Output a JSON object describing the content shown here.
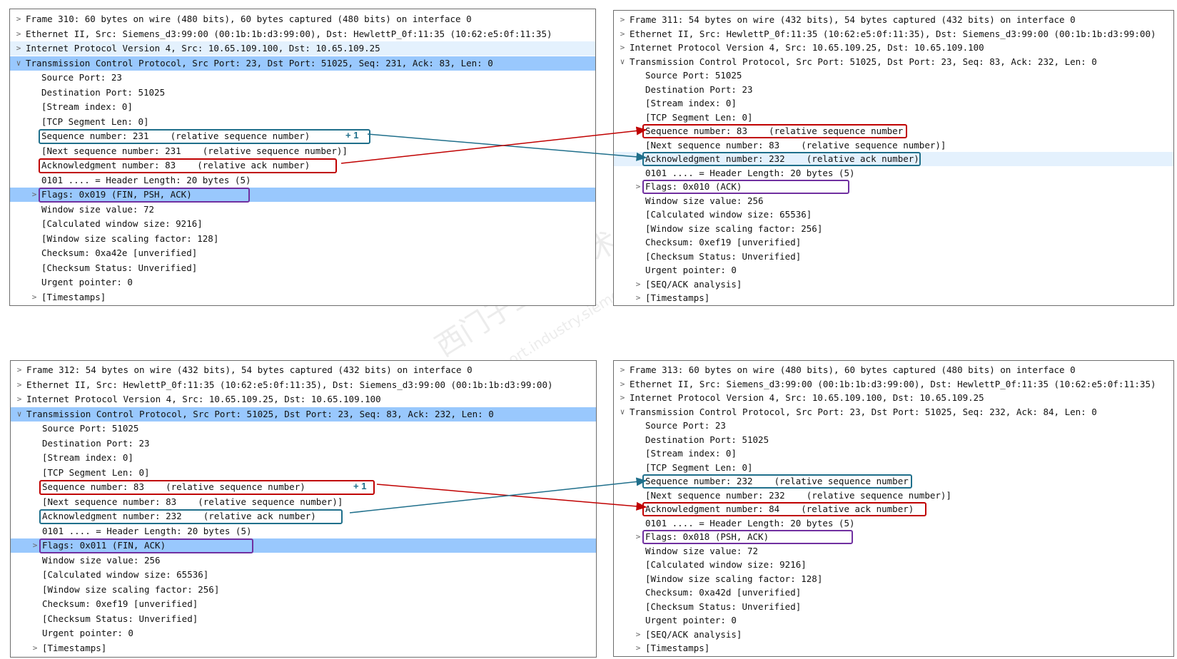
{
  "watermark": {
    "line1": "西门子工业 技术",
    "line2": "support.industry.siemens.com"
  },
  "frames": [
    {
      "id": "frame-310",
      "rows": [
        {
          "text": "Frame 310: 60 bytes on wire (480 bits), 60 bytes captured (480 bits) on interface 0",
          "arrow": ">",
          "indent": 0
        },
        {
          "text": "Ethernet II, Src: Siemens_d3:99:00 (00:1b:1b:d3:99:00), Dst: HewlettP_0f:11:35 (10:62:e5:0f:11:35)",
          "arrow": ">",
          "indent": 0
        },
        {
          "text": "Internet Protocol Version 4, Src: 10.65.109.100, Dst: 10.65.109.25",
          "arrow": ">",
          "indent": 0,
          "hl": true
        },
        {
          "text": "Transmission Control Protocol, Src Port: 23, Dst Port: 51025, Seq: 231, Ack: 83, Len: 0",
          "arrow": "v",
          "indent": 0,
          "sel": true
        },
        {
          "text": "Source Port: 23",
          "arrow": "",
          "indent": 1
        },
        {
          "text": "Destination Port: 51025",
          "arrow": "",
          "indent": 1
        },
        {
          "text": "[Stream index: 0]",
          "arrow": "",
          "indent": 1
        },
        {
          "text": "[TCP Segment Len: 0]",
          "arrow": "",
          "indent": 1
        },
        {
          "text": "Sequence number: 231    (relative sequence number)",
          "arrow": "",
          "indent": 1
        },
        {
          "text": "[Next sequence number: 231    (relative sequence number)]",
          "arrow": "",
          "indent": 1
        },
        {
          "text": "Acknowledgment number: 83    (relative ack number)",
          "arrow": "",
          "indent": 1
        },
        {
          "text": "0101 .... = Header Length: 20 bytes (5)",
          "arrow": "",
          "indent": 1
        },
        {
          "text": "Flags: 0x019 (FIN, PSH, ACK)",
          "arrow": ">",
          "indent": 1,
          "sel": true
        },
        {
          "text": "Window size value: 72",
          "arrow": "",
          "indent": 1
        },
        {
          "text": "[Calculated window size: 9216]",
          "arrow": "",
          "indent": 1
        },
        {
          "text": "[Window size scaling factor: 128]",
          "arrow": "",
          "indent": 1
        },
        {
          "text": "Checksum: 0xa42e [unverified]",
          "arrow": "",
          "indent": 1
        },
        {
          "text": "[Checksum Status: Unverified]",
          "arrow": "",
          "indent": 1
        },
        {
          "text": "Urgent pointer: 0",
          "arrow": "",
          "indent": 1
        },
        {
          "text": "[Timestamps]",
          "arrow": ">",
          "indent": 1
        }
      ],
      "plus": "+ 1"
    },
    {
      "id": "frame-311",
      "rows": [
        {
          "text": "Frame 311: 54 bytes on wire (432 bits), 54 bytes captured (432 bits) on interface 0",
          "arrow": ">",
          "indent": 0
        },
        {
          "text": "Ethernet II, Src: HewlettP_0f:11:35 (10:62:e5:0f:11:35), Dst: Siemens_d3:99:00 (00:1b:1b:d3:99:00)",
          "arrow": ">",
          "indent": 0
        },
        {
          "text": "Internet Protocol Version 4, Src: 10.65.109.25, Dst: 10.65.109.100",
          "arrow": ">",
          "indent": 0
        },
        {
          "text": "Transmission Control Protocol, Src Port: 51025, Dst Port: 23, Seq: 83, Ack: 232, Len: 0",
          "arrow": "v",
          "indent": 0
        },
        {
          "text": "Source Port: 51025",
          "arrow": "",
          "indent": 1
        },
        {
          "text": "Destination Port: 23",
          "arrow": "",
          "indent": 1
        },
        {
          "text": "[Stream index: 0]",
          "arrow": "",
          "indent": 1
        },
        {
          "text": "[TCP Segment Len: 0]",
          "arrow": "",
          "indent": 1
        },
        {
          "text": "Sequence number: 83    (relative sequence number",
          "arrow": "",
          "indent": 1
        },
        {
          "text": "[Next sequence number: 83    (relative sequence number)]",
          "arrow": "",
          "indent": 1
        },
        {
          "text": "Acknowledgment number: 232    (relative ack number)",
          "arrow": "",
          "indent": 1,
          "hl": true
        },
        {
          "text": "0101 .... = Header Length: 20 bytes (5)",
          "arrow": "",
          "indent": 1
        },
        {
          "text": "Flags: 0x010 (ACK)",
          "arrow": ">",
          "indent": 1
        },
        {
          "text": "Window size value: 256",
          "arrow": "",
          "indent": 1
        },
        {
          "text": "[Calculated window size: 65536]",
          "arrow": "",
          "indent": 1
        },
        {
          "text": "[Window size scaling factor: 256]",
          "arrow": "",
          "indent": 1
        },
        {
          "text": "Checksum: 0xef19 [unverified]",
          "arrow": "",
          "indent": 1
        },
        {
          "text": "[Checksum Status: Unverified]",
          "arrow": "",
          "indent": 1
        },
        {
          "text": "Urgent pointer: 0",
          "arrow": "",
          "indent": 1
        },
        {
          "text": "[SEQ/ACK analysis]",
          "arrow": ">",
          "indent": 1
        },
        {
          "text": "[Timestamps]",
          "arrow": ">",
          "indent": 1
        }
      ]
    },
    {
      "id": "frame-312",
      "rows": [
        {
          "text": "Frame 312: 54 bytes on wire (432 bits), 54 bytes captured (432 bits) on interface 0",
          "arrow": ">",
          "indent": 0
        },
        {
          "text": "Ethernet II, Src: HewlettP_0f:11:35 (10:62:e5:0f:11:35), Dst: Siemens_d3:99:00 (00:1b:1b:d3:99:00)",
          "arrow": ">",
          "indent": 0
        },
        {
          "text": "Internet Protocol Version 4, Src: 10.65.109.25, Dst: 10.65.109.100",
          "arrow": ">",
          "indent": 0
        },
        {
          "text": "Transmission Control Protocol, Src Port: 51025, Dst Port: 23, Seq: 83, Ack: 232, Len: 0",
          "arrow": "v",
          "indent": 0,
          "sel": true
        },
        {
          "text": "Source Port: 51025",
          "arrow": "",
          "indent": 1
        },
        {
          "text": "Destination Port: 23",
          "arrow": "",
          "indent": 1
        },
        {
          "text": "[Stream index: 0]",
          "arrow": "",
          "indent": 1
        },
        {
          "text": "[TCP Segment Len: 0]",
          "arrow": "",
          "indent": 1
        },
        {
          "text": "Sequence number: 83    (relative sequence number)",
          "arrow": "",
          "indent": 1
        },
        {
          "text": "[Next sequence number: 83    (relative sequence number)]",
          "arrow": "",
          "indent": 1
        },
        {
          "text": "Acknowledgment number: 232    (relative ack number)",
          "arrow": "",
          "indent": 1
        },
        {
          "text": "0101 .... = Header Length: 20 bytes (5)",
          "arrow": "",
          "indent": 1
        },
        {
          "text": "Flags: 0x011 (FIN, ACK)",
          "arrow": ">",
          "indent": 1,
          "sel": true
        },
        {
          "text": "Window size value: 256",
          "arrow": "",
          "indent": 1
        },
        {
          "text": "[Calculated window size: 65536]",
          "arrow": "",
          "indent": 1
        },
        {
          "text": "[Window size scaling factor: 256]",
          "arrow": "",
          "indent": 1
        },
        {
          "text": "Checksum: 0xef19 [unverified]",
          "arrow": "",
          "indent": 1
        },
        {
          "text": "[Checksum Status: Unverified]",
          "arrow": "",
          "indent": 1
        },
        {
          "text": "Urgent pointer: 0",
          "arrow": "",
          "indent": 1
        },
        {
          "text": "[Timestamps]",
          "arrow": ">",
          "indent": 1
        }
      ],
      "plus": "+ 1"
    },
    {
      "id": "frame-313",
      "rows": [
        {
          "text": "Frame 313: 60 bytes on wire (480 bits), 60 bytes captured (480 bits) on interface 0",
          "arrow": ">",
          "indent": 0
        },
        {
          "text": "Ethernet II, Src: Siemens_d3:99:00 (00:1b:1b:d3:99:00), Dst: HewlettP_0f:11:35 (10:62:e5:0f:11:35)",
          "arrow": ">",
          "indent": 0
        },
        {
          "text": "Internet Protocol Version 4, Src: 10.65.109.100, Dst: 10.65.109.25",
          "arrow": ">",
          "indent": 0
        },
        {
          "text": "Transmission Control Protocol, Src Port: 23, Dst Port: 51025, Seq: 232, Ack: 84, Len: 0",
          "arrow": "v",
          "indent": 0
        },
        {
          "text": "Source Port: 23",
          "arrow": "",
          "indent": 1
        },
        {
          "text": "Destination Port: 51025",
          "arrow": "",
          "indent": 1
        },
        {
          "text": "[Stream index: 0]",
          "arrow": "",
          "indent": 1
        },
        {
          "text": "[TCP Segment Len: 0]",
          "arrow": "",
          "indent": 1
        },
        {
          "text": "Sequence number: 232    (relative sequence number",
          "arrow": "",
          "indent": 1
        },
        {
          "text": "[Next sequence number: 232    (relative sequence number)]",
          "arrow": "",
          "indent": 1
        },
        {
          "text": "Acknowledgment number: 84    (relative ack number)",
          "arrow": "",
          "indent": 1
        },
        {
          "text": "0101 .... = Header Length: 20 bytes (5)",
          "arrow": "",
          "indent": 1
        },
        {
          "text": "Flags: 0x018 (PSH, ACK)",
          "arrow": ">",
          "indent": 1
        },
        {
          "text": "Window size value: 72",
          "arrow": "",
          "indent": 1
        },
        {
          "text": "[Calculated window size: 9216]",
          "arrow": "",
          "indent": 1
        },
        {
          "text": "[Window size scaling factor: 128]",
          "arrow": "",
          "indent": 1
        },
        {
          "text": "Checksum: 0xa42d [unverified]",
          "arrow": "",
          "indent": 1
        },
        {
          "text": "[Checksum Status: Unverified]",
          "arrow": "",
          "indent": 1
        },
        {
          "text": "Urgent pointer: 0",
          "arrow": "",
          "indent": 1
        },
        {
          "text": "[SEQ/ACK analysis]",
          "arrow": ">",
          "indent": 1
        },
        {
          "text": "[Timestamps]",
          "arrow": ">",
          "indent": 1
        }
      ]
    }
  ],
  "colors": {
    "red": "#c00000",
    "teal": "#1f6f8b",
    "purple": "#7030a0",
    "selection": "#99c8fd"
  }
}
